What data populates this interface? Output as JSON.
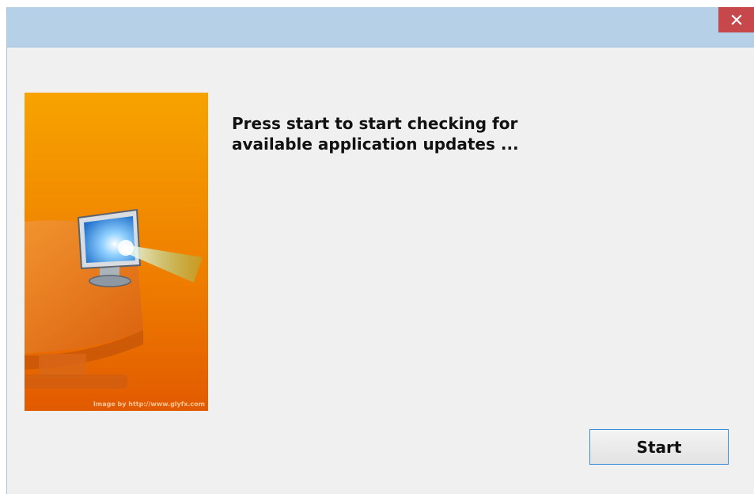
{
  "window": {
    "close_glyph": "✕"
  },
  "message": {
    "line1": "Press start to start checking for",
    "line2": "available application updates ..."
  },
  "banner": {
    "credit": "Image by http://www.glyfx.com",
    "icon": "monitor-update-icon"
  },
  "actions": {
    "start_label": "Start"
  },
  "colors": {
    "titlebar": "#b6d0e8",
    "close": "#c7484b",
    "banner_top": "#f7a300",
    "banner_bottom": "#e25a00",
    "button_focus": "#3c8fd6"
  }
}
